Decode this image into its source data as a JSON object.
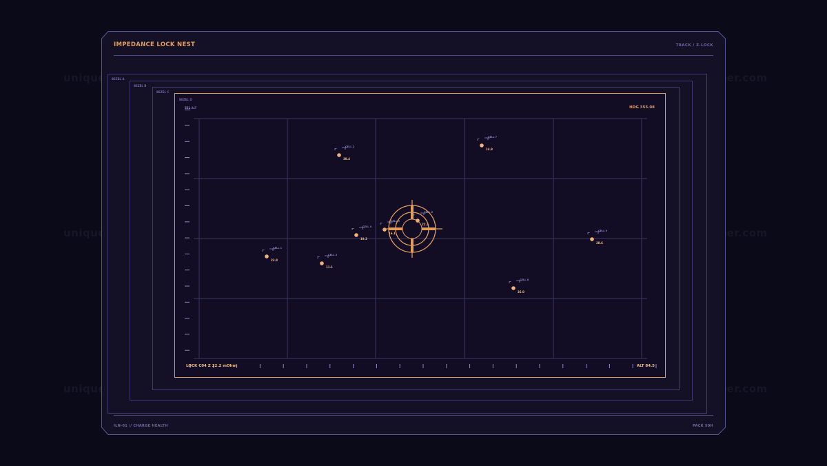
{
  "header": {
    "title": "IMPEDANCE LOCK NEST",
    "track": "TRACK / Z-LOCK"
  },
  "footer": {
    "left": "ILN-01 // CHARGE HEALTH",
    "right": "PACK 50H"
  },
  "bezels": [
    "BEZEL A",
    "BEZEL B",
    "BEZEL C",
    "BEZEL D"
  ],
  "screen": {
    "hdg": "HDG 355.08",
    "lock": "LOCK C04 Z 22.2 mOhm",
    "alt": "ALT 84.5",
    "sel_underline": "SEL",
    "sel_rest": "ALT"
  },
  "cells": [
    {
      "id": "CELL 1",
      "value": "23.8"
    },
    {
      "id": "CELL 2",
      "value": "38.4"
    },
    {
      "id": "CELL 3",
      "value": "11.1"
    },
    {
      "id": "CELL 4",
      "value": "19.2"
    },
    {
      "id": "CELL 5",
      "value": "16.1"
    },
    {
      "id": "CELL 6",
      "value": "22.2"
    },
    {
      "id": "CELL 7",
      "value": "14.9"
    },
    {
      "id": "CELL 8",
      "value": "26.0"
    },
    {
      "id": "CELL 9",
      "value": "28.6"
    }
  ],
  "watermark": "uniquelivewallpaper.com",
  "colors": {
    "accent": "#e39d5a",
    "frame": "#4a4680",
    "background": "#0b0a18"
  }
}
